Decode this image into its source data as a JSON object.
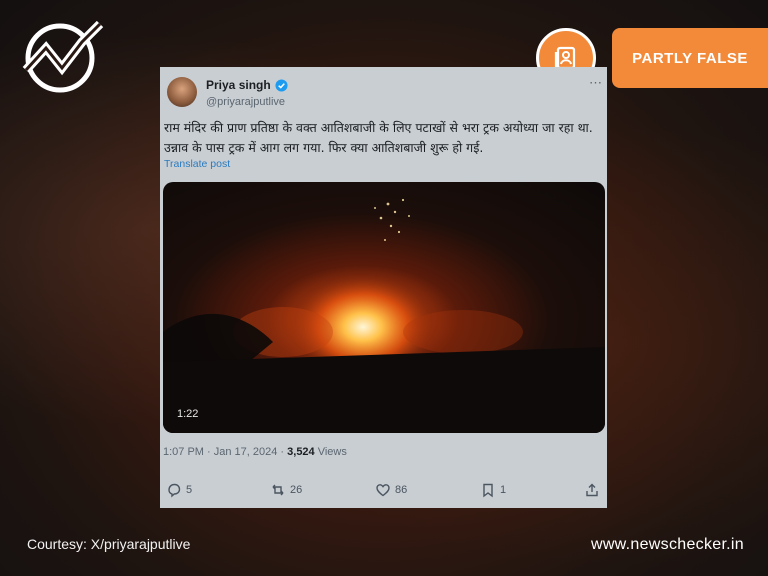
{
  "badge": {
    "label": "PARTLY FALSE",
    "color": "#f28a3a"
  },
  "tweet": {
    "author_name": "Priya singh",
    "author_handle": "@priyarajputlive",
    "more_icon": "⋯",
    "text": "राम मंदिर की प्राण प्रतिष्ठा के वक्त आतिशबाजी के लिए पटाखों से भरा ट्रक अयोध्या जा रहा था. उन्नाव के पास ट्रक में आग लग गया. फिर क्या आतिशबाजी शुरू हो गई.",
    "translate_label": "Translate post",
    "video_duration": "1:22",
    "timestamp": "1:07 PM · Jan 17, 2024 · ",
    "views_count": "3,524",
    "views_label": " Views",
    "replies": "5",
    "reposts": "26",
    "likes": "86",
    "bookmarks": "1"
  },
  "footer": {
    "courtesy": "Courtesy: X/priyarajputlive",
    "site": "www.newschecker.in"
  }
}
